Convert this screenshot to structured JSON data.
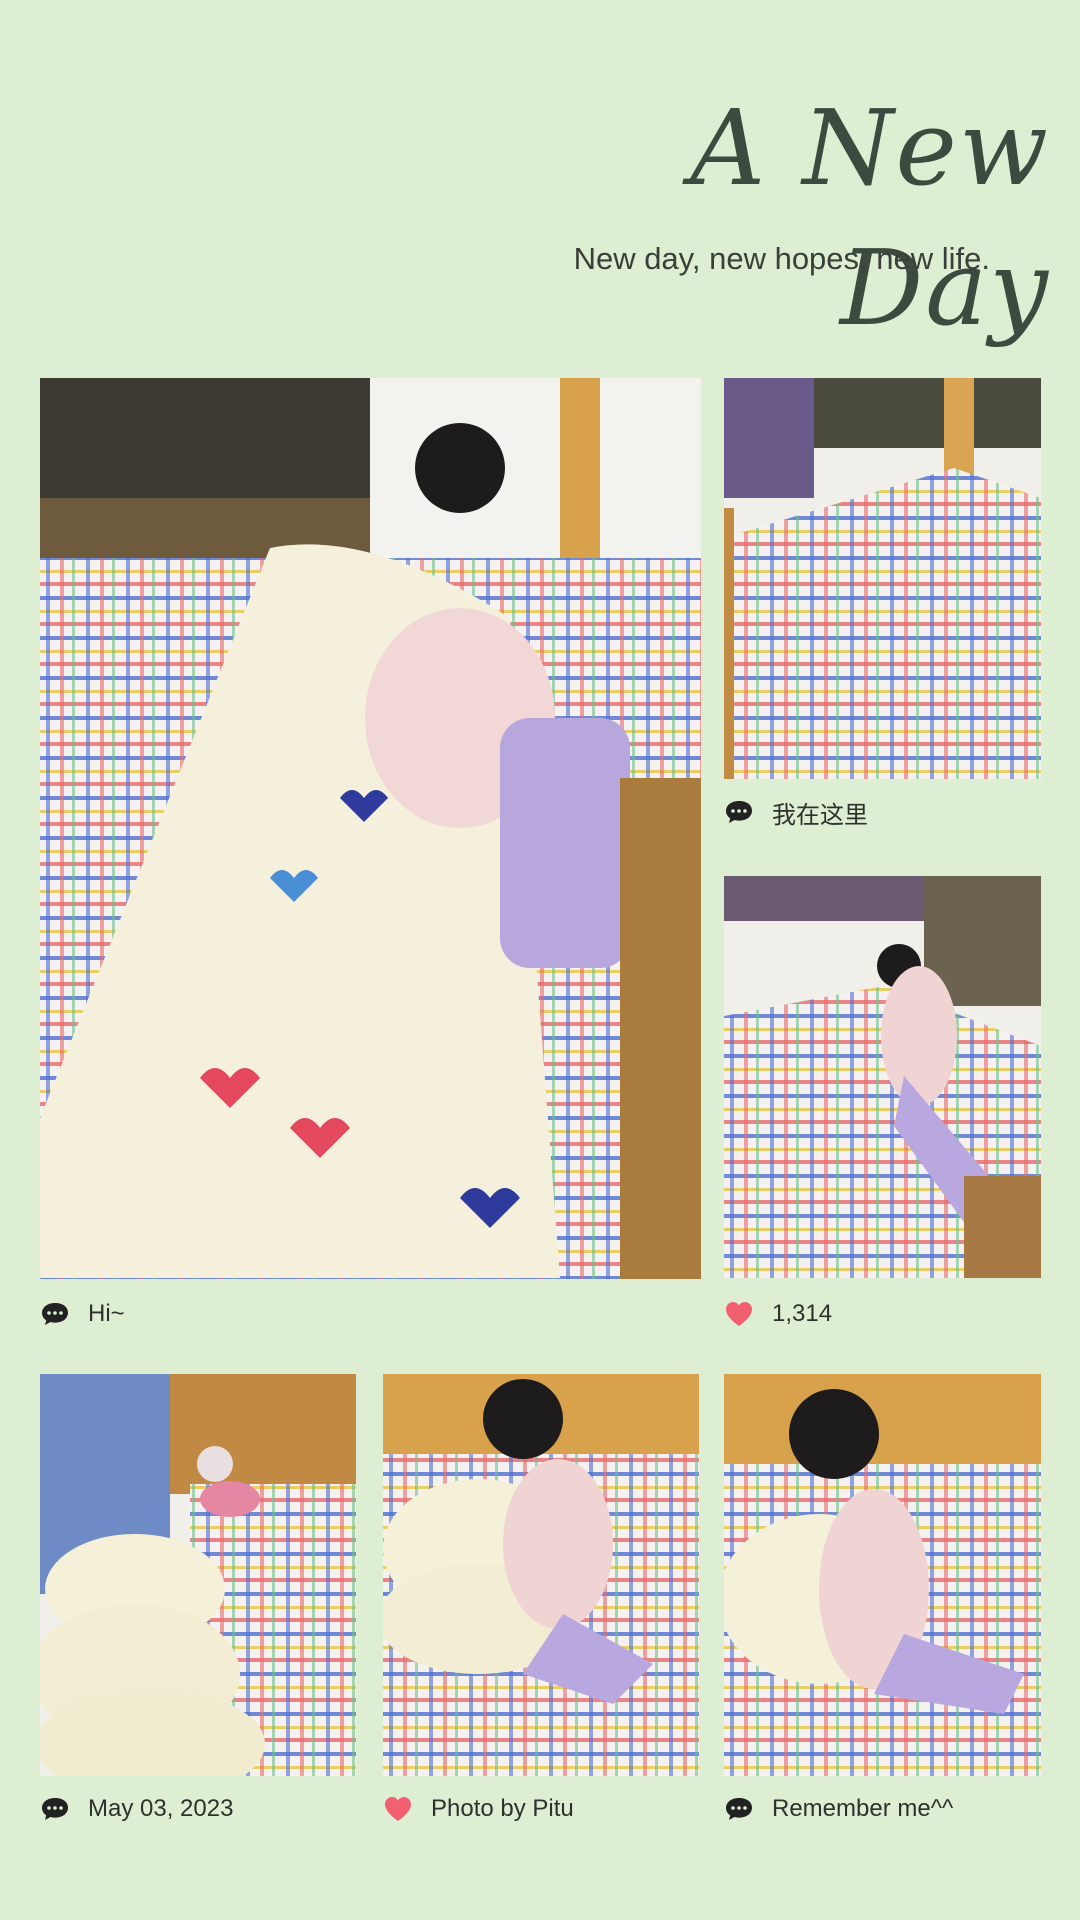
{
  "header": {
    "title": "A New Day",
    "subtitle": "New day, new hopes, new life."
  },
  "captions": {
    "main": {
      "icon": "comment-icon",
      "text": "Hi~"
    },
    "top_right": {
      "icon": "comment-icon",
      "text": "我在这里"
    },
    "middle_right": {
      "icon": "heart-icon",
      "text": "1,314"
    },
    "bottom_left": {
      "icon": "comment-icon",
      "text": "May 03, 2023"
    },
    "bottom_center": {
      "icon": "heart-icon",
      "text": "Photo by Pitu"
    },
    "bottom_right": {
      "icon": "comment-icon",
      "text": "Remember me^^"
    }
  },
  "colors": {
    "background": "#deeed2",
    "heart": "#f06070",
    "text": "#2e312e"
  }
}
